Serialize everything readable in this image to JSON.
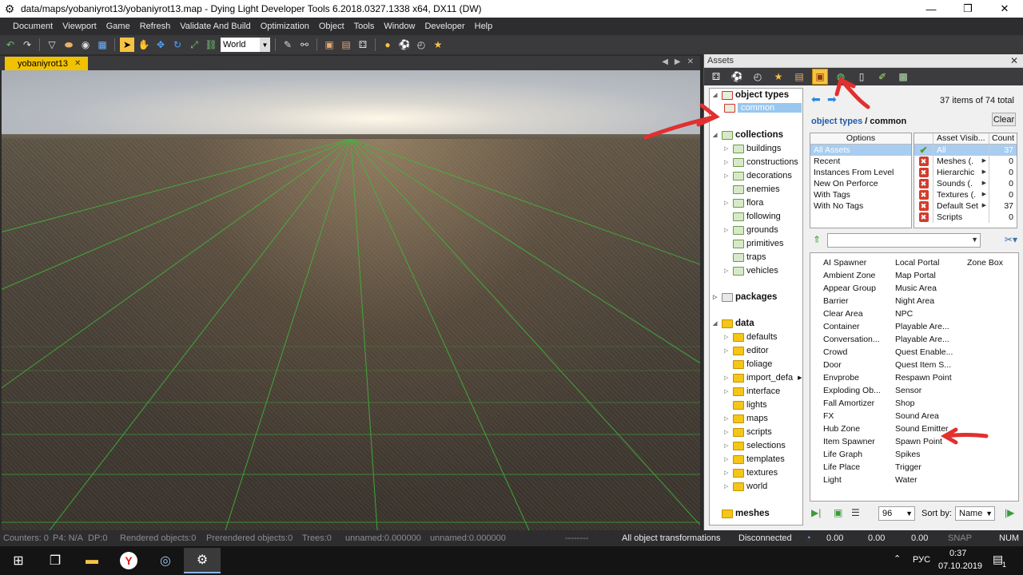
{
  "window": {
    "title": "data/maps/yobaniyrot13/yobaniyrot13.map - Dying Light Developer Tools 6.2018.0327.1338 x64, DX11 (DW)",
    "minimize": "—",
    "maximize": "❐",
    "close": "✕"
  },
  "menu": [
    "Document",
    "Viewport",
    "Game",
    "Refresh",
    "Validate And Build",
    "Optimization",
    "Object",
    "Tools",
    "Window",
    "Developer",
    "Help"
  ],
  "toolbar": {
    "coord_space": "World"
  },
  "viewport": {
    "tab_label": "yobaniyrot13",
    "tab_close": "✕"
  },
  "statusbar": {
    "counters": "Counters: 0",
    "p4": "P4: N/A",
    "dp": "DP:0",
    "rendered": "Rendered objects:0",
    "prerendered": "Prerendered objects:0",
    "trees": "Trees:0",
    "unnamed1": "unnamed:0.000000",
    "unnamed2": "unnamed:0.000000",
    "dashes": "--------",
    "transform": "All object transformations",
    "connection": "Disconnected",
    "v1": "0.00",
    "v2": "0.00",
    "v3": "0.00",
    "snap": "SNAP",
    "num": "NUM"
  },
  "assets": {
    "title": "Assets",
    "count_text": "37 items of 74 total",
    "breadcrumb_link": "object types",
    "breadcrumb_sep": "/",
    "breadcrumb_current": "common",
    "clear_label": "Clear",
    "tree": {
      "object_types": "object types",
      "common": "common",
      "collections": "collections",
      "collections_children": [
        "buildings",
        "constructions",
        "decorations",
        "enemies",
        "flora",
        "following",
        "grounds",
        "primitives",
        "traps",
        "vehicles"
      ],
      "packages": "packages",
      "data": "data",
      "data_children": [
        "defaults",
        "editor",
        "foliage",
        "import_defa",
        "interface",
        "lights",
        "maps",
        "scripts",
        "selections",
        "templates",
        "textures",
        "world"
      ],
      "meshes": "meshes"
    },
    "options": {
      "header": "Options",
      "rows": [
        "All Assets",
        "Recent",
        "Instances From Level",
        "New On Perforce",
        "With Tags",
        "With No Tags"
      ]
    },
    "visibility": {
      "header_name": "Asset Visib...",
      "header_count": "Count",
      "rows": [
        {
          "name": "All",
          "count": "37"
        },
        {
          "name": "Meshes (.",
          "count": "0"
        },
        {
          "name": "Hierarchic",
          "count": "0"
        },
        {
          "name": "Sounds (.",
          "count": "0"
        },
        {
          "name": "Textures (.",
          "count": "0"
        },
        {
          "name": "Default Set",
          "count": "37"
        },
        {
          "name": "Scripts",
          "count": "0"
        }
      ]
    },
    "items_col1": [
      "AI Spawner",
      "Ambient Zone",
      "Appear Group",
      "Barrier",
      "Clear Area",
      "Container",
      "Conversation...",
      "Crowd",
      "Door",
      "Envprobe",
      "Exploding Ob...",
      "Fall Amortizer",
      "FX",
      "Hub Zone",
      "Item Spawner",
      "Life Graph",
      "Life Place",
      "Light"
    ],
    "items_col2": [
      "Local Portal",
      "Map Portal",
      "Music Area",
      "Night Area",
      "NPC",
      "Playable Are...",
      "Playable Are...",
      "Quest Enable...",
      "Quest Item S...",
      "Respawn Point",
      "Sensor",
      "Shop",
      "Sound Area",
      "Sound Emitter",
      "Spawn Point",
      "Spikes",
      "Trigger",
      "Water"
    ],
    "items_col3": [
      "Zone Box"
    ],
    "size_value": "96",
    "sort_label": "Sort by:",
    "sort_value": "Name"
  },
  "taskbar": {
    "lang": "РУС",
    "time": "0:37",
    "date": "07.10.2019",
    "notif": "1"
  }
}
